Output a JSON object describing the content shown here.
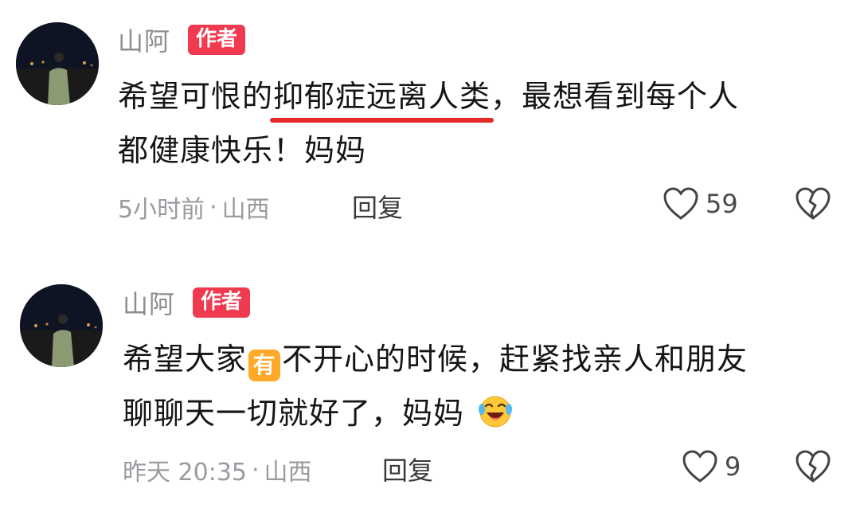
{
  "comments": [
    {
      "username": "山阿",
      "badge": "作者",
      "text_pre": "希望可恨的",
      "text_underlined": "抑郁症远离人类",
      "text_post": "，最想看到每个人",
      "text_line2": "都健康快乐！妈妈",
      "time": "5小时前",
      "separator": "·",
      "location": "山西",
      "reply_label": "回复",
      "like_count": "59"
    },
    {
      "username": "山阿",
      "badge": "作者",
      "text_pre": "希望大家",
      "sticker": "有",
      "text_post": "不开心的时候，赶紧找亲人和朋友",
      "text_line2": "聊聊天一切就好了，妈妈",
      "time": "昨天 20:35",
      "separator": "·",
      "location": "山西",
      "reply_label": "回复",
      "like_count": "9"
    }
  ],
  "icons": {
    "like": "heart-outline-icon",
    "dislike": "broken-heart-icon",
    "emoji": "laughing-crying-emoji"
  },
  "colors": {
    "badge": "#f03a4f",
    "underline": "#e52a2a",
    "sticker": "#ffa928"
  }
}
